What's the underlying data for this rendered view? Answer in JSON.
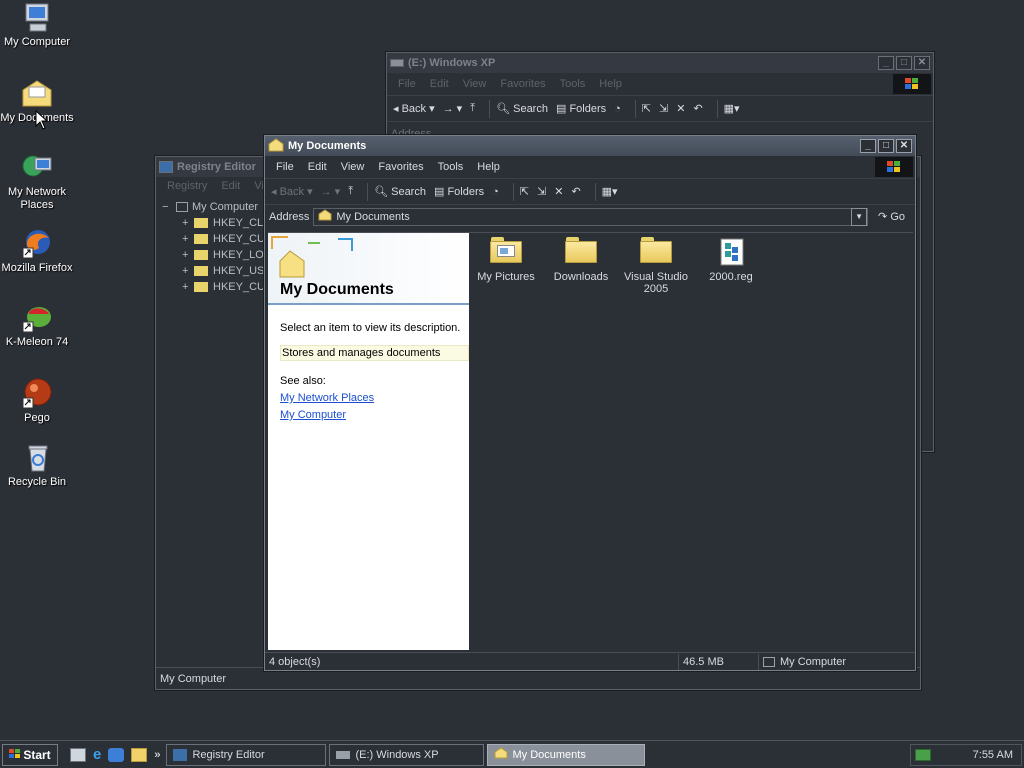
{
  "desktop": {
    "icons": [
      {
        "label": "My Computer"
      },
      {
        "label": "My Documents"
      },
      {
        "label": "My Network Places"
      },
      {
        "label": "Mozilla Firefox"
      },
      {
        "label": "K-Meleon 74"
      },
      {
        "label": "Pego"
      },
      {
        "label": "Recycle Bin"
      }
    ]
  },
  "win_xp": {
    "title": "(E:) Windows XP",
    "menu": [
      "File",
      "Edit",
      "View",
      "Favorites",
      "Tools",
      "Help"
    ],
    "toolbar": {
      "back": "Back",
      "search": "Search",
      "folders": "Folders"
    },
    "address_label": "Address"
  },
  "regedit": {
    "title": "Registry Editor",
    "menu": [
      "Registry",
      "Edit",
      "View"
    ],
    "tree_root": "My Computer",
    "keys": [
      "HKEY_CL",
      "HKEY_CU",
      "HKEY_LO",
      "HKEY_US",
      "HKEY_CU"
    ],
    "status": "My Computer"
  },
  "mydocs": {
    "title": "My Documents",
    "menu": [
      "File",
      "Edit",
      "View",
      "Favorites",
      "Tools",
      "Help"
    ],
    "toolbar": {
      "back": "Back",
      "search": "Search",
      "folders": "Folders"
    },
    "address_label": "Address",
    "address_value": "My Documents",
    "go": "Go",
    "panel": {
      "heading": "My Documents",
      "prompt": "Select an item to view its description.",
      "description": "Stores and manages documents",
      "see_also": "See also:",
      "links": [
        "My Network Places",
        "My Computer"
      ]
    },
    "items": [
      {
        "label": "My Pictures",
        "icon": "pictures-folder-icon"
      },
      {
        "label": "Downloads",
        "icon": "folder-icon"
      },
      {
        "label": "Visual Studio 2005",
        "icon": "folder-icon"
      },
      {
        "label": "2000.reg",
        "icon": "registry-file-icon"
      }
    ],
    "status": {
      "count": "4 object(s)",
      "size": "46.5 MB",
      "zone": "My Computer"
    }
  },
  "taskbar": {
    "start": "Start",
    "tasks": [
      {
        "label": "Registry Editor",
        "active": false
      },
      {
        "label": "(E:) Windows XP",
        "active": false
      },
      {
        "label": "My Documents",
        "active": true
      }
    ],
    "clock": "7:55 AM"
  }
}
